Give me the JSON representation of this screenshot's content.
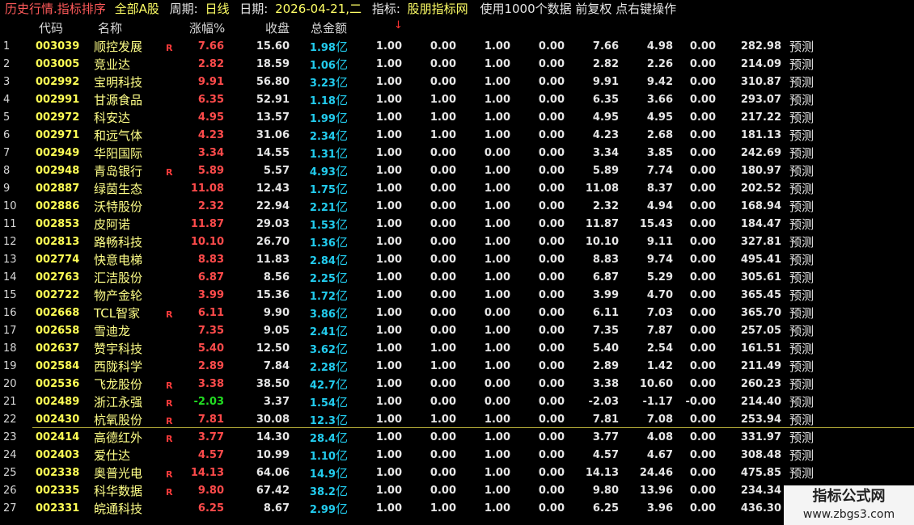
{
  "title": {
    "segment1": "历史行情.指标排序",
    "segment2": "全部A股",
    "period_label": "周期:",
    "period_value": "日线",
    "date_label": "日期:",
    "date_value": "2026-04-21,二",
    "indicator_label": "指标:",
    "indicator_value": "股朋指标网",
    "info": "使用1000个数据 前复权 点右键操作"
  },
  "columns": {
    "code": "代码",
    "name": "名称",
    "change": "涨幅%",
    "close": "收盘",
    "amount": "总金额",
    "sort_arrow": "↓"
  },
  "rows": [
    {
      "idx": "1",
      "code": "003039",
      "name": "顺控发展",
      "r": "R",
      "chg": "7.66",
      "dir": "up",
      "close": "15.60",
      "amt": "1.98",
      "unit": "亿",
      "v": [
        "1.00",
        "0.00",
        "1.00",
        "0.00",
        "7.66",
        "4.98",
        "0.00",
        "282.98"
      ],
      "pred": "预测"
    },
    {
      "idx": "2",
      "code": "003005",
      "name": "竞业达",
      "r": "",
      "chg": "2.82",
      "dir": "up",
      "close": "18.59",
      "amt": "1.06",
      "unit": "亿",
      "v": [
        "1.00",
        "0.00",
        "1.00",
        "0.00",
        "2.82",
        "2.26",
        "0.00",
        "214.09"
      ],
      "pred": "预测"
    },
    {
      "idx": "3",
      "code": "002992",
      "name": "宝明科技",
      "r": "",
      "chg": "9.91",
      "dir": "up",
      "close": "56.80",
      "amt": "3.23",
      "unit": "亿",
      "v": [
        "1.00",
        "0.00",
        "1.00",
        "0.00",
        "9.91",
        "9.42",
        "0.00",
        "310.87"
      ],
      "pred": "预测"
    },
    {
      "idx": "4",
      "code": "002991",
      "name": "甘源食品",
      "r": "",
      "chg": "6.35",
      "dir": "up",
      "close": "52.91",
      "amt": "1.18",
      "unit": "亿",
      "v": [
        "1.00",
        "1.00",
        "1.00",
        "0.00",
        "6.35",
        "3.66",
        "0.00",
        "293.07"
      ],
      "pred": "预测"
    },
    {
      "idx": "5",
      "code": "002972",
      "name": "科安达",
      "r": "",
      "chg": "4.95",
      "dir": "up",
      "close": "13.57",
      "amt": "1.99",
      "unit": "亿",
      "v": [
        "1.00",
        "1.00",
        "1.00",
        "0.00",
        "4.95",
        "4.95",
        "0.00",
        "217.22"
      ],
      "pred": "预测"
    },
    {
      "idx": "6",
      "code": "002971",
      "name": "和远气体",
      "r": "",
      "chg": "4.23",
      "dir": "up",
      "close": "31.06",
      "amt": "2.34",
      "unit": "亿",
      "v": [
        "1.00",
        "1.00",
        "1.00",
        "0.00",
        "4.23",
        "2.68",
        "0.00",
        "181.13"
      ],
      "pred": "预测"
    },
    {
      "idx": "7",
      "code": "002949",
      "name": "华阳国际",
      "r": "",
      "chg": "3.34",
      "dir": "up",
      "close": "14.55",
      "amt": "1.31",
      "unit": "亿",
      "v": [
        "1.00",
        "0.00",
        "0.00",
        "0.00",
        "3.34",
        "3.85",
        "0.00",
        "242.69"
      ],
      "pred": "预测"
    },
    {
      "idx": "8",
      "code": "002948",
      "name": "青岛银行",
      "r": "R",
      "chg": "5.89",
      "dir": "up",
      "close": "5.57",
      "amt": "4.93",
      "unit": "亿",
      "v": [
        "1.00",
        "0.00",
        "1.00",
        "0.00",
        "5.89",
        "7.74",
        "0.00",
        "180.97"
      ],
      "pred": "预测"
    },
    {
      "idx": "9",
      "code": "002887",
      "name": "绿茵生态",
      "r": "",
      "chg": "11.08",
      "dir": "up",
      "close": "12.43",
      "amt": "1.75",
      "unit": "亿",
      "v": [
        "1.00",
        "0.00",
        "1.00",
        "0.00",
        "11.08",
        "8.37",
        "0.00",
        "202.52"
      ],
      "pred": "预测"
    },
    {
      "idx": "10",
      "code": "002886",
      "name": "沃特股份",
      "r": "",
      "chg": "2.32",
      "dir": "up",
      "close": "22.94",
      "amt": "2.21",
      "unit": "亿",
      "v": [
        "1.00",
        "0.00",
        "1.00",
        "0.00",
        "2.32",
        "4.94",
        "0.00",
        "168.94"
      ],
      "pred": "预测"
    },
    {
      "idx": "11",
      "code": "002853",
      "name": "皮阿诺",
      "r": "",
      "chg": "11.87",
      "dir": "up",
      "close": "29.03",
      "amt": "1.53",
      "unit": "亿",
      "v": [
        "1.00",
        "0.00",
        "1.00",
        "0.00",
        "11.87",
        "15.43",
        "0.00",
        "184.47"
      ],
      "pred": "预测"
    },
    {
      "idx": "12",
      "code": "002813",
      "name": "路畅科技",
      "r": "",
      "chg": "10.10",
      "dir": "up",
      "close": "26.70",
      "amt": "1.36",
      "unit": "亿",
      "v": [
        "1.00",
        "0.00",
        "1.00",
        "0.00",
        "10.10",
        "9.11",
        "0.00",
        "327.81"
      ],
      "pred": "预测"
    },
    {
      "idx": "13",
      "code": "002774",
      "name": "快意电梯",
      "r": "",
      "chg": "8.83",
      "dir": "up",
      "close": "11.83",
      "amt": "2.84",
      "unit": "亿",
      "v": [
        "1.00",
        "0.00",
        "1.00",
        "0.00",
        "8.83",
        "9.74",
        "0.00",
        "495.41"
      ],
      "pred": "预测"
    },
    {
      "idx": "14",
      "code": "002763",
      "name": "汇洁股份",
      "r": "",
      "chg": "6.87",
      "dir": "up",
      "close": "8.56",
      "amt": "2.25",
      "unit": "亿",
      "v": [
        "1.00",
        "0.00",
        "1.00",
        "0.00",
        "6.87",
        "5.29",
        "0.00",
        "305.61"
      ],
      "pred": "预测"
    },
    {
      "idx": "15",
      "code": "002722",
      "name": "物产金轮",
      "r": "",
      "chg": "3.99",
      "dir": "up",
      "close": "15.36",
      "amt": "1.72",
      "unit": "亿",
      "v": [
        "1.00",
        "0.00",
        "1.00",
        "0.00",
        "3.99",
        "4.70",
        "0.00",
        "365.45"
      ],
      "pred": "预测"
    },
    {
      "idx": "16",
      "code": "002668",
      "name": "TCL智家",
      "r": "R",
      "chg": "6.11",
      "dir": "up",
      "close": "9.90",
      "amt": "3.86",
      "unit": "亿",
      "v": [
        "1.00",
        "0.00",
        "0.00",
        "0.00",
        "6.11",
        "7.03",
        "0.00",
        "365.70"
      ],
      "pred": "预测"
    },
    {
      "idx": "17",
      "code": "002658",
      "name": "雪迪龙",
      "r": "",
      "chg": "7.35",
      "dir": "up",
      "close": "9.05",
      "amt": "2.41",
      "unit": "亿",
      "v": [
        "1.00",
        "0.00",
        "1.00",
        "0.00",
        "7.35",
        "7.87",
        "0.00",
        "257.05"
      ],
      "pred": "预测"
    },
    {
      "idx": "18",
      "code": "002637",
      "name": "赞宇科技",
      "r": "",
      "chg": "5.40",
      "dir": "up",
      "close": "12.50",
      "amt": "3.62",
      "unit": "亿",
      "v": [
        "1.00",
        "1.00",
        "1.00",
        "0.00",
        "5.40",
        "2.54",
        "0.00",
        "161.51"
      ],
      "pred": "预测"
    },
    {
      "idx": "19",
      "code": "002584",
      "name": "西陇科学",
      "r": "",
      "chg": "2.89",
      "dir": "up",
      "close": "7.84",
      "amt": "2.28",
      "unit": "亿",
      "v": [
        "1.00",
        "1.00",
        "1.00",
        "0.00",
        "2.89",
        "1.42",
        "0.00",
        "211.49"
      ],
      "pred": "预测"
    },
    {
      "idx": "20",
      "code": "002536",
      "name": "飞龙股份",
      "r": "R",
      "chg": "3.38",
      "dir": "up",
      "close": "38.50",
      "amt": "42.7",
      "unit": "亿",
      "v": [
        "1.00",
        "0.00",
        "0.00",
        "0.00",
        "3.38",
        "10.60",
        "0.00",
        "260.23"
      ],
      "pred": "预测"
    },
    {
      "idx": "21",
      "code": "002489",
      "name": "浙江永强",
      "r": "R",
      "chg": "-2.03",
      "dir": "down",
      "close": "3.37",
      "amt": "1.54",
      "unit": "亿",
      "v": [
        "1.00",
        "0.00",
        "0.00",
        "0.00",
        "-2.03",
        "-1.17",
        "-0.00",
        "214.40"
      ],
      "pred": "预测"
    },
    {
      "idx": "22",
      "code": "002430",
      "name": "杭氧股份",
      "r": "R",
      "chg": "7.81",
      "dir": "up",
      "close": "30.08",
      "amt": "12.3",
      "unit": "亿",
      "v": [
        "1.00",
        "1.00",
        "1.00",
        "0.00",
        "7.81",
        "7.08",
        "0.00",
        "253.94"
      ],
      "pred": "预测"
    },
    {
      "idx": "23",
      "code": "002414",
      "name": "高德红外",
      "r": "R",
      "chg": "3.77",
      "dir": "up",
      "close": "14.30",
      "amt": "28.4",
      "unit": "亿",
      "v": [
        "1.00",
        "0.00",
        "1.00",
        "0.00",
        "3.77",
        "4.08",
        "0.00",
        "331.97"
      ],
      "pred": "预测"
    },
    {
      "idx": "24",
      "code": "002403",
      "name": "爱仕达",
      "r": "",
      "chg": "4.57",
      "dir": "up",
      "close": "10.99",
      "amt": "1.10",
      "unit": "亿",
      "v": [
        "1.00",
        "0.00",
        "1.00",
        "0.00",
        "4.57",
        "4.67",
        "0.00",
        "308.48"
      ],
      "pred": "预测"
    },
    {
      "idx": "25",
      "code": "002338",
      "name": "奥普光电",
      "r": "R",
      "chg": "14.13",
      "dir": "up",
      "close": "64.06",
      "amt": "14.9",
      "unit": "亿",
      "v": [
        "1.00",
        "0.00",
        "1.00",
        "0.00",
        "14.13",
        "24.46",
        "0.00",
        "475.85"
      ],
      "pred": "预测"
    },
    {
      "idx": "26",
      "code": "002335",
      "name": "科华数据",
      "r": "R",
      "chg": "9.80",
      "dir": "up",
      "close": "67.42",
      "amt": "38.2",
      "unit": "亿",
      "v": [
        "1.00",
        "0.00",
        "1.00",
        "0.00",
        "9.80",
        "13.96",
        "0.00",
        "234.34"
      ],
      "pred": ""
    },
    {
      "idx": "27",
      "code": "002331",
      "name": "皖通科技",
      "r": "",
      "chg": "6.25",
      "dir": "up",
      "close": "8.67",
      "amt": "2.99",
      "unit": "亿",
      "v": [
        "1.00",
        "1.00",
        "1.00",
        "0.00",
        "6.25",
        "3.96",
        "0.00",
        "436.30"
      ],
      "pred": ""
    }
  ],
  "watermark": {
    "line1": "指标公式网",
    "line2": "www.zbgs3.com"
  }
}
